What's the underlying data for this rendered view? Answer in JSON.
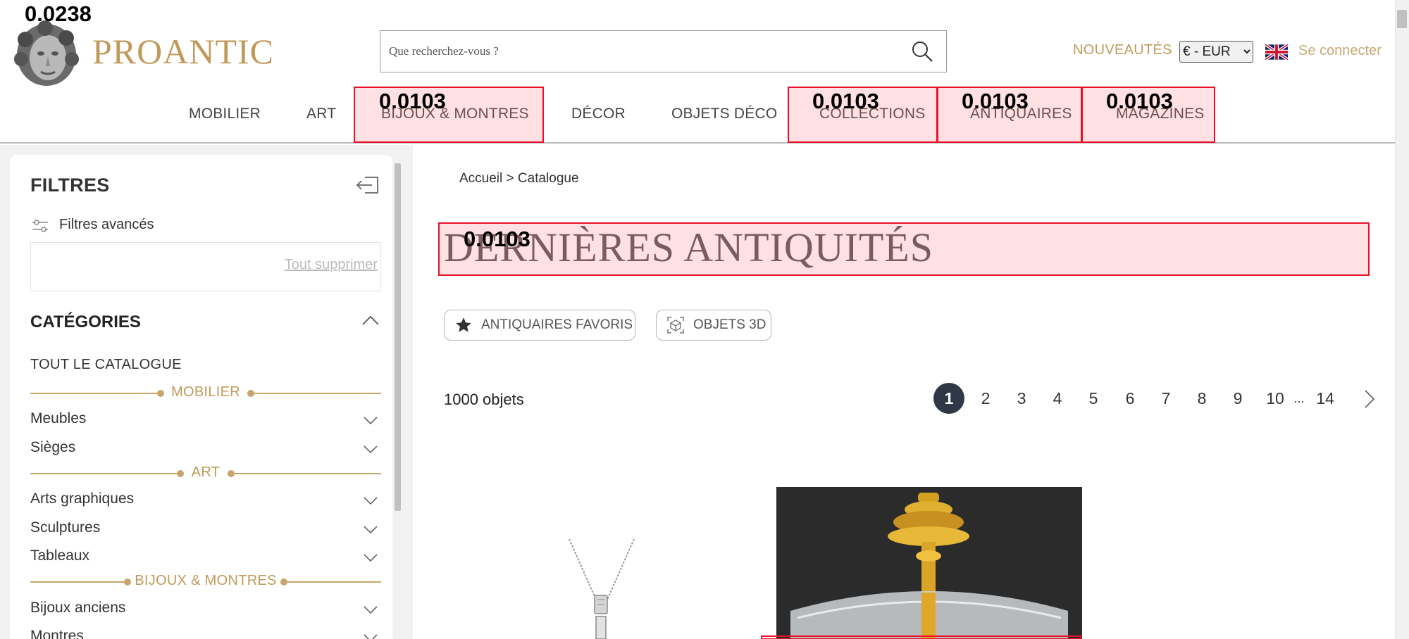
{
  "header": {
    "brand": "PROANTIC",
    "search": {
      "placeholder": "Que recherchez-vous ?"
    },
    "nouveautes": "NOUVEAUTÉS",
    "currency": "€ - EUR",
    "login": "Se connecter"
  },
  "nav": {
    "items": [
      "MOBILIER",
      "ART",
      "BIJOUX & MONTRES",
      "DÉCOR",
      "OBJETS DÉCO",
      "COLLECTIONS",
      "ANTIQUAIRES",
      "MAGAZINES"
    ]
  },
  "overlays": {
    "logo_score": "0.0238",
    "bijoux_score": "0.0103",
    "collections_score": "0.0103",
    "antiquaires_score": "0.0103",
    "magazines_score": "0.0103",
    "title_score": "0.0103"
  },
  "sidebar": {
    "filters_title": "FILTRES",
    "advanced_filters": "Filtres avancés",
    "clear_all": "Tout supprimer",
    "categories_title": "CATÉGORIES",
    "all_catalogue": "TOUT LE CATALOGUE",
    "sections": [
      {
        "label": "MOBILIER",
        "items": [
          "Meubles",
          "Sièges"
        ]
      },
      {
        "label": "ART",
        "items": [
          "Arts graphiques",
          "Sculptures",
          "Tableaux"
        ]
      },
      {
        "label": "BIJOUX & MONTRES",
        "items": [
          "Bijoux anciens",
          "Montres"
        ]
      }
    ]
  },
  "main": {
    "breadcrumb": "Accueil > Catalogue",
    "title": "DERNIÈRES ANTIQUITÉS",
    "pill_favorites": "ANTIQUAIRES FAVORIS",
    "pill_3d": "OBJETS 3D",
    "count": "1000 objets",
    "pages": [
      "1",
      "2",
      "3",
      "4",
      "5",
      "6",
      "7",
      "8",
      "9",
      "10",
      "...",
      "14"
    ],
    "current_page": "1"
  },
  "colors": {
    "gold": "#c19a5b",
    "dark_navy": "#2f3847",
    "highlight_red": "#e8102a"
  }
}
